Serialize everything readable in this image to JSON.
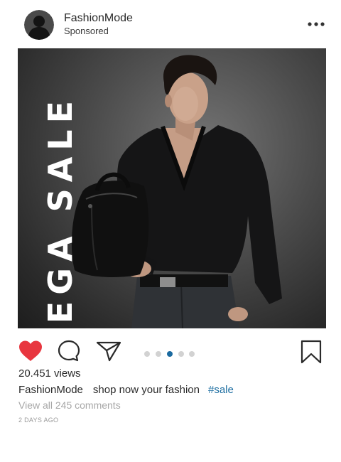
{
  "header": {
    "account_name": "FashionMode",
    "sponsored_label": "Sponsored",
    "avatar_icon": "user-silhouette-icon",
    "more_icon": "more-horizontal-icon"
  },
  "post": {
    "overlay_text": "MEGA SALE",
    "image_subject": "model in dark sweater holding black leather bag"
  },
  "actions": {
    "like_icon": "heart-filled-icon",
    "comment_icon": "comment-bubble-icon",
    "share_icon": "send-paper-plane-icon",
    "save_icon": "bookmark-icon",
    "liked": true,
    "carousel_count": 5,
    "carousel_active_index": 2
  },
  "stats": {
    "views": "20.451 views"
  },
  "caption": {
    "username": "FashionMode",
    "text": "shop now your fashion",
    "hashtag": "#sale"
  },
  "comments": {
    "view_all": "View all 245 comments"
  },
  "timestamp": "2 DAYS AGO",
  "colors": {
    "like_red": "#e8363f",
    "hashtag_blue": "#1f6fa2",
    "active_dot": "#1b6aa0",
    "inactive_dot": "#d2d2d2",
    "muted_text": "#a7a7a7"
  }
}
